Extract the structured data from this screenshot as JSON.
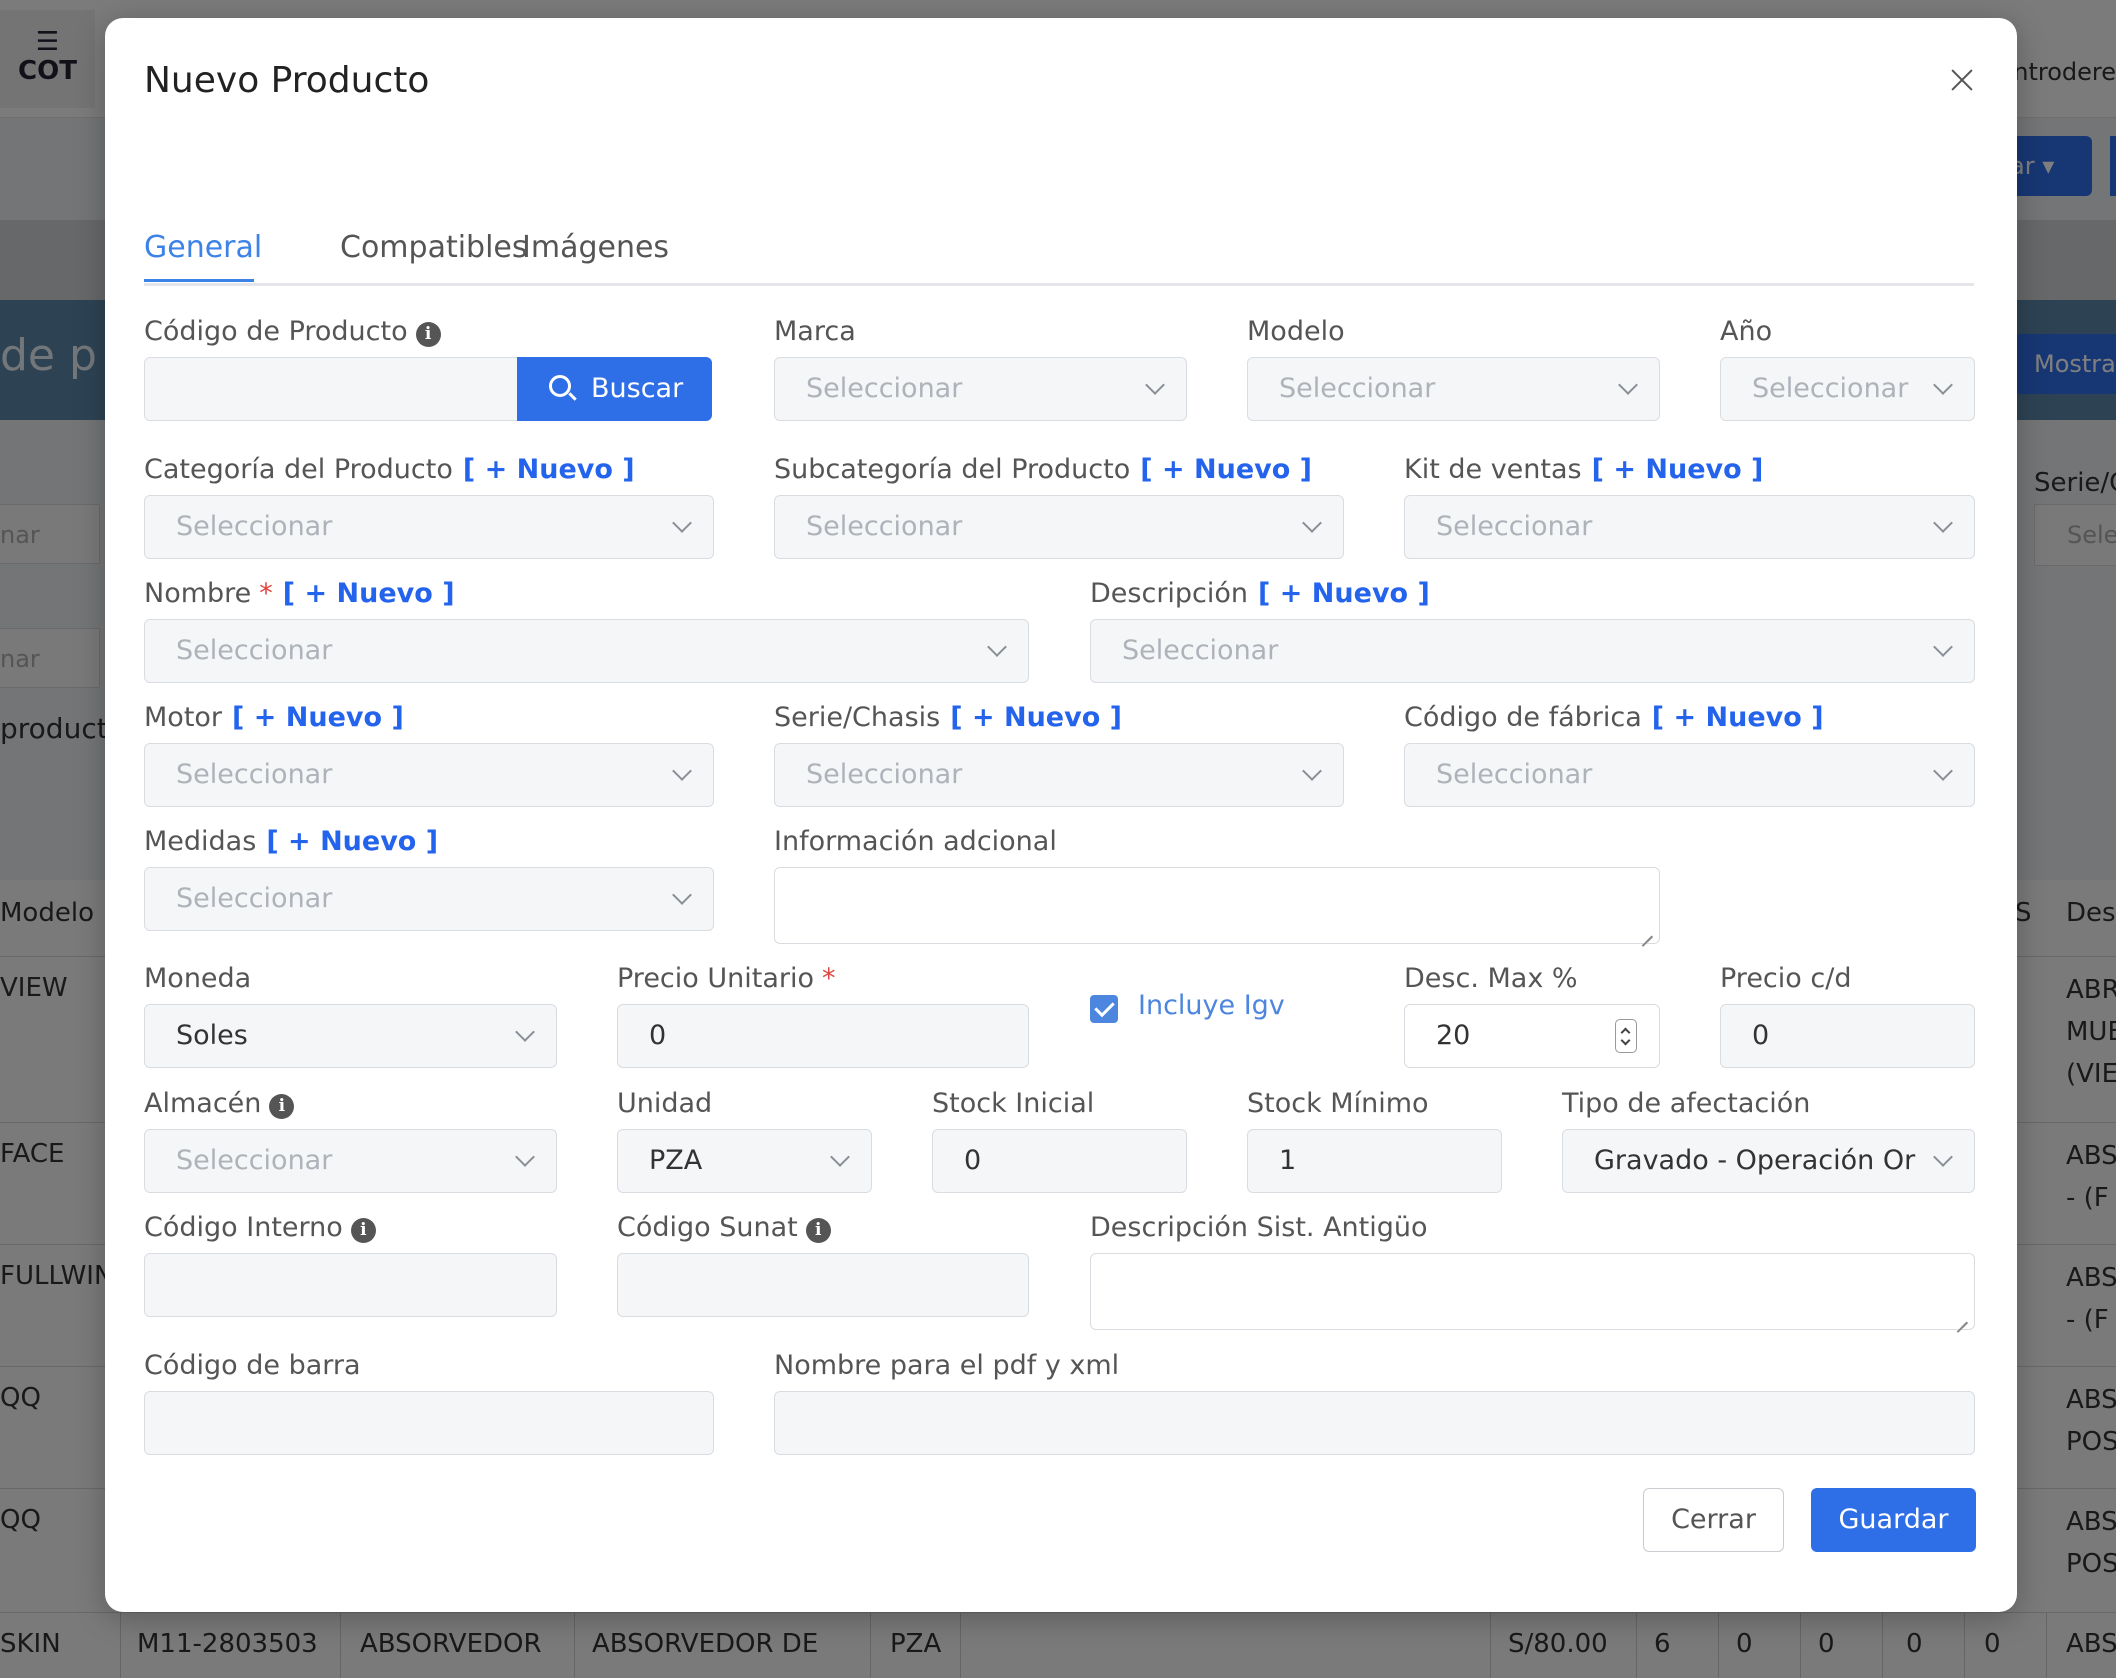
{
  "background": {
    "app_badge": "COT",
    "user_fragment": "entrodere",
    "action_button": "ar",
    "header_title": "de p",
    "mostrar_button": "Mostra",
    "left_fields": [
      "nar",
      "nar"
    ],
    "right_label": "Serie/C",
    "right_field": "Sele",
    "productos_label": "producto",
    "table_header": {
      "modelo": "Modelo",
      "s": "S",
      "desc": "Des"
    },
    "rows": [
      {
        "modelo": "VIEW",
        "desc": [
          "ABR",
          "MUE",
          "(VIE"
        ]
      },
      {
        "modelo": "FACE",
        "desc": [
          "ABS",
          "- (F"
        ]
      },
      {
        "modelo": "FULLWIN",
        "desc": [
          "ABS",
          "- (F"
        ]
      },
      {
        "modelo": "QQ",
        "desc": [
          "ABS",
          "POS"
        ]
      },
      {
        "modelo": "QQ",
        "desc": [
          "ABS",
          "POS"
        ]
      }
    ],
    "last_row": {
      "modelo": "SKIN",
      "codigo": "M11-2803503",
      "nombre": "ABSORVEDOR",
      "descripcion": "ABSORVEDOR DE",
      "unidad": "PZA",
      "precio": "S/80.00",
      "n1": "6",
      "n2": "0",
      "n3": "0",
      "n4": "0",
      "n5": "0",
      "desc": "ABS"
    }
  },
  "modal": {
    "title": "Nuevo Producto",
    "tabs": [
      "General",
      "Compatibles",
      "Imágenes"
    ],
    "nuevo_tag": "[ + Nuevo ]",
    "placeholder": "Seleccionar",
    "fields": {
      "codigo_producto": {
        "label": "Código de Producto",
        "value": ""
      },
      "buscar_button": "Buscar",
      "marca": {
        "label": "Marca"
      },
      "modelo": {
        "label": "Modelo"
      },
      "anio": {
        "label": "Año"
      },
      "categoria": {
        "label": "Categoría del Producto"
      },
      "subcategoria": {
        "label": "Subcategoría del Producto"
      },
      "kit_ventas": {
        "label": "Kit de ventas"
      },
      "nombre": {
        "label": "Nombre",
        "required": "*"
      },
      "descripcion": {
        "label": "Descripción"
      },
      "motor": {
        "label": "Motor"
      },
      "serie_chasis": {
        "label": "Serie/Chasis"
      },
      "codigo_fabrica": {
        "label": "Código de fábrica"
      },
      "medidas": {
        "label": "Medidas"
      },
      "info_adicional": {
        "label": "Información adcional",
        "value": ""
      },
      "moneda": {
        "label": "Moneda",
        "value": "Soles"
      },
      "precio_unitario": {
        "label": "Precio Unitario",
        "required": "*",
        "value": "0"
      },
      "incluye_igv": {
        "label": "Incluye Igv",
        "checked": true
      },
      "desc_max": {
        "label": "Desc. Max %",
        "value": "20"
      },
      "precio_cd": {
        "label": "Precio c/d",
        "value": "0"
      },
      "almacen": {
        "label": "Almacén"
      },
      "unidad": {
        "label": "Unidad",
        "value": "PZA"
      },
      "stock_inicial": {
        "label": "Stock Inicial",
        "value": "0"
      },
      "stock_minimo": {
        "label": "Stock Mínimo",
        "value": "1"
      },
      "tipo_afectacion": {
        "label": "Tipo de afectación",
        "value": "Gravado - Operación Or"
      },
      "codigo_interno": {
        "label": "Código Interno",
        "value": ""
      },
      "codigo_sunat": {
        "label": "Código Sunat",
        "value": ""
      },
      "desc_sist_antiguo": {
        "label": "Descripción Sist. Antigüo",
        "value": ""
      },
      "codigo_barra": {
        "label": "Código de barra",
        "value": ""
      },
      "nombre_pdf_xml": {
        "label": "Nombre para el pdf y xml",
        "value": ""
      }
    },
    "buttons": {
      "cerrar": "Cerrar",
      "guardar": "Guardar"
    }
  }
}
